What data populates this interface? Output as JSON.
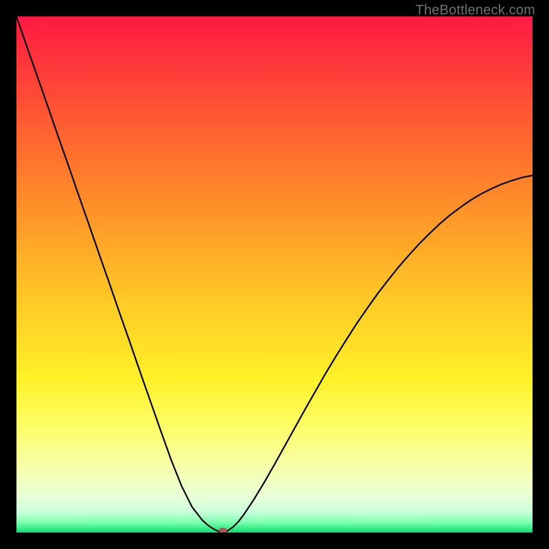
{
  "watermark": {
    "text": "TheBottleneck.com"
  },
  "chart_data": {
    "type": "line",
    "title": "",
    "xlabel": "",
    "ylabel": "",
    "xlim": [
      0,
      100
    ],
    "ylim": [
      0,
      100
    ],
    "grid": false,
    "legend": false,
    "marker": {
      "x": 40,
      "y": 0,
      "color": "#b0535b",
      "rx": 6,
      "ry": 4
    },
    "series": [
      {
        "name": "curve",
        "color": "#000000",
        "x": [
          0,
          2,
          4,
          6,
          8,
          10,
          12,
          14,
          16,
          18,
          20,
          22,
          24,
          26,
          28,
          30,
          32,
          34,
          36,
          37,
          38,
          39,
          39.5,
          40,
          40.5,
          41,
          42,
          43,
          44,
          46,
          48,
          50,
          52,
          54,
          56,
          58,
          60,
          62,
          64,
          66,
          68,
          70,
          72,
          74,
          76,
          78,
          80,
          82,
          84,
          86,
          88,
          90,
          92,
          94,
          96,
          98,
          100
        ],
        "y": [
          100,
          94.2,
          88.5,
          82.8,
          77,
          71.3,
          65.5,
          59.8,
          54,
          48.3,
          42.5,
          36.8,
          31,
          25.3,
          19.6,
          14,
          9,
          5,
          2.4,
          1.5,
          0.8,
          0.3,
          0.1,
          0,
          0.1,
          0.4,
          1.1,
          2.1,
          3.4,
          6.4,
          9.7,
          13.2,
          16.8,
          20.4,
          24,
          27.5,
          31,
          34.3,
          37.5,
          40.6,
          43.5,
          46.3,
          48.9,
          51.4,
          53.7,
          55.9,
          57.9,
          59.8,
          61.5,
          63,
          64.4,
          65.6,
          66.6,
          67.5,
          68.2,
          68.8,
          69.2
        ]
      }
    ],
    "background": {
      "type": "vertical-gradient",
      "stops": [
        {
          "p": 0,
          "color": "#ff1a44"
        },
        {
          "p": 10,
          "color": "#ff3a3a"
        },
        {
          "p": 25,
          "color": "#ff6a2e"
        },
        {
          "p": 40,
          "color": "#ff9a28"
        },
        {
          "p": 55,
          "color": "#ffc926"
        },
        {
          "p": 70,
          "color": "#fff028"
        },
        {
          "p": 80,
          "color": "#fdff6a"
        },
        {
          "p": 88,
          "color": "#f6ffb0"
        },
        {
          "p": 93,
          "color": "#e8ffd6"
        },
        {
          "p": 96,
          "color": "#caffdc"
        },
        {
          "p": 98,
          "color": "#7dffb0"
        },
        {
          "p": 100,
          "color": "#0be070"
        }
      ]
    }
  }
}
